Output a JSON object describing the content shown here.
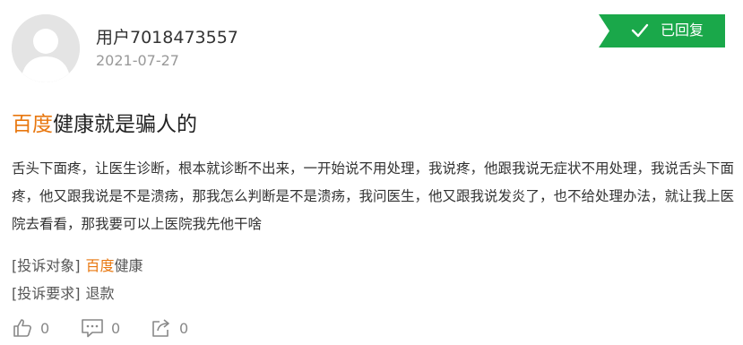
{
  "user": {
    "name": "用户7018473557",
    "date": "2021-07-27"
  },
  "badge": {
    "label": "已回复",
    "color": "#1aa84a",
    "icon": "check-icon"
  },
  "complaint": {
    "title_highlight": "百度",
    "title_rest": "健康就是骗人的",
    "body": "舌头下面疼，让医生诊断，根本就诊断不出来，一开始说不用处理，我说疼，他跟我说无症状不用处理，我说舌头下面疼，他又跟我说是不是溃疡，那我怎么判断是不是溃疡，我问医生，他又跟我说发炎了，也不给处理办法，就让我上医院去看看，那我要可以上医院我先他干啥"
  },
  "meta": {
    "target_label": "[投诉对象]",
    "target_highlight": "百度",
    "target_rest": "健康",
    "request_label": "[投诉要求]",
    "request_value": "退款"
  },
  "actions": {
    "like_count": "0",
    "comment_count": "0",
    "share_count": "0",
    "like_icon": "thumbs-up-icon",
    "comment_icon": "comment-icon",
    "share_icon": "share-icon"
  },
  "colors": {
    "accent": "#e8770f",
    "badge": "#1aa84a"
  }
}
